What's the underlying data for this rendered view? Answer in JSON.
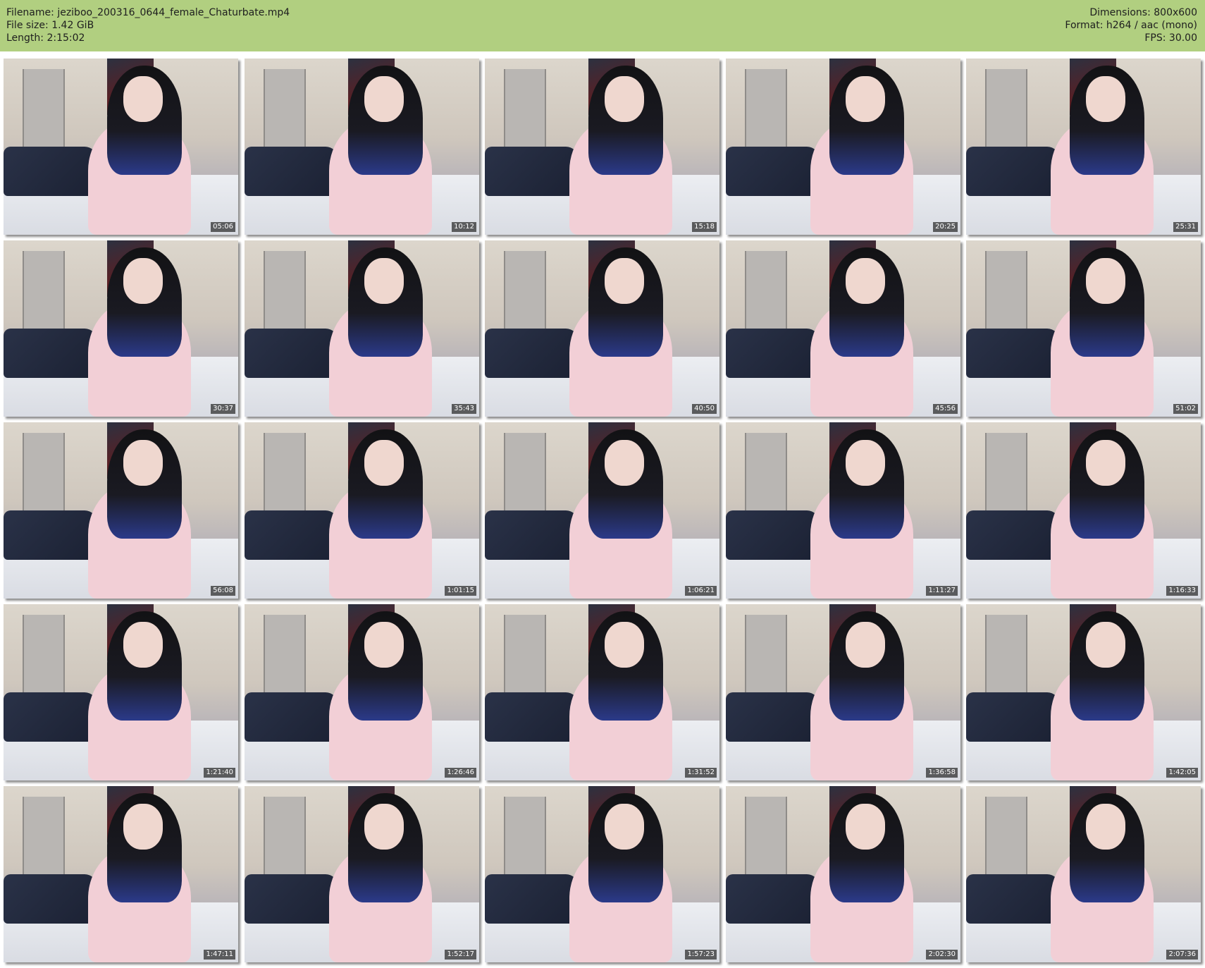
{
  "header": {
    "filename_label": "Filename:",
    "filename": "jeziboo_200316_0644_female_Chaturbate.mp4",
    "filesize_label": "File size:",
    "filesize": "1.42 GiB",
    "length_label": "Length:",
    "length": "2:15:02",
    "dimensions_label": "Dimensions:",
    "dimensions": "800x600",
    "format_label": "Format:",
    "format": "h264 / aac (mono)",
    "fps_label": "FPS:",
    "fps": "30.00",
    "background_color": "#b1cf80"
  },
  "thumbnails": [
    {
      "timestamp": "05:06"
    },
    {
      "timestamp": "10:12"
    },
    {
      "timestamp": "15:18"
    },
    {
      "timestamp": "20:25"
    },
    {
      "timestamp": "25:31"
    },
    {
      "timestamp": "30:37"
    },
    {
      "timestamp": "35:43"
    },
    {
      "timestamp": "40:50"
    },
    {
      "timestamp": "45:56"
    },
    {
      "timestamp": "51:02"
    },
    {
      "timestamp": "56:08"
    },
    {
      "timestamp": "1:01:15"
    },
    {
      "timestamp": "1:06:21"
    },
    {
      "timestamp": "1:11:27"
    },
    {
      "timestamp": "1:16:33"
    },
    {
      "timestamp": "1:21:40"
    },
    {
      "timestamp": "1:26:46"
    },
    {
      "timestamp": "1:31:52"
    },
    {
      "timestamp": "1:36:58"
    },
    {
      "timestamp": "1:42:05"
    },
    {
      "timestamp": "1:47:11"
    },
    {
      "timestamp": "1:52:17"
    },
    {
      "timestamp": "1:57:23"
    },
    {
      "timestamp": "2:02:30"
    },
    {
      "timestamp": "2:07:36"
    }
  ]
}
